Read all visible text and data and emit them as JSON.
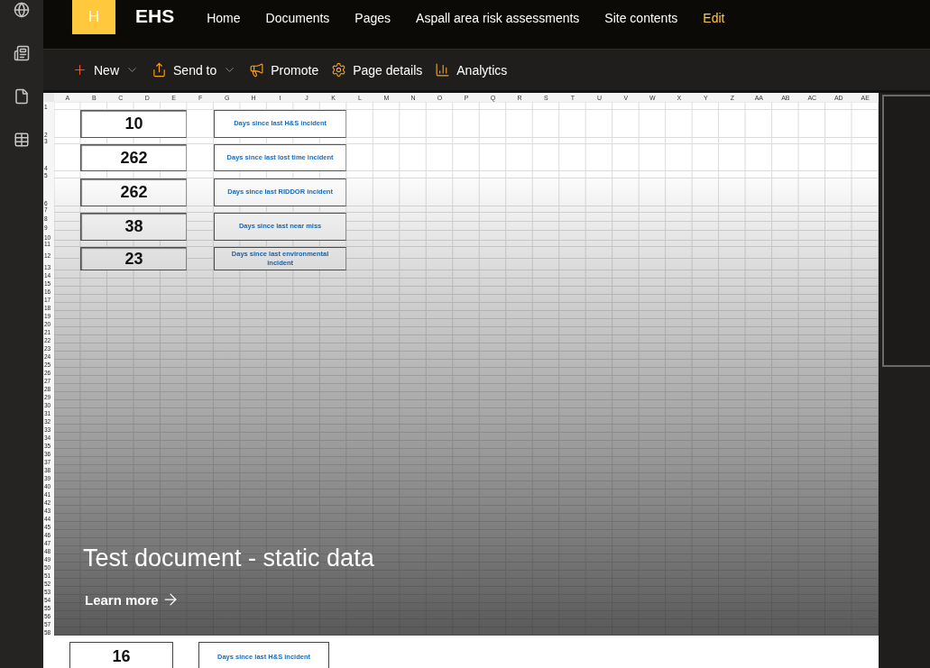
{
  "site": {
    "logo_letter": "H",
    "title": "EHS"
  },
  "nav": [
    {
      "label": "Home",
      "kind": "link"
    },
    {
      "label": "Documents",
      "kind": "link"
    },
    {
      "label": "Pages",
      "kind": "link"
    },
    {
      "label": "Aspall area risk assessments",
      "kind": "link"
    },
    {
      "label": "Site contents",
      "kind": "link"
    },
    {
      "label": "Edit",
      "kind": "edit"
    }
  ],
  "commands": [
    {
      "label": "New",
      "dropdown": true
    },
    {
      "label": "Send to",
      "dropdown": true
    },
    {
      "label": "Promote",
      "dropdown": false
    },
    {
      "label": "Page details",
      "dropdown": false
    },
    {
      "label": "Analytics",
      "dropdown": false
    }
  ],
  "hero": {
    "title": "Test document - static data",
    "link": "Learn more",
    "sheet": {
      "columns": [
        "A",
        "B",
        "C",
        "D",
        "E",
        "F",
        "G",
        "H",
        "I",
        "J",
        "K",
        "L",
        "M",
        "N",
        "O",
        "P",
        "Q",
        "R",
        "S",
        "T",
        "U",
        "V",
        "W",
        "X",
        "Y",
        "Z",
        "AA",
        "AB",
        "AC",
        "AD",
        "AE"
      ],
      "rows": [
        "1",
        "2",
        "3",
        "4",
        "5",
        "6",
        "7",
        "8",
        "9",
        "10",
        "11",
        "12",
        "13",
        "14",
        "15",
        "16",
        "17",
        "18",
        "19",
        "20",
        "21",
        "22",
        "23",
        "24",
        "25",
        "26",
        "27",
        "28",
        "29",
        "30",
        "31",
        "32",
        "33",
        "34",
        "35",
        "36",
        "37",
        "38",
        "39",
        "40",
        "41",
        "42",
        "43",
        "44",
        "45",
        "46",
        "47",
        "48",
        "49",
        "50",
        "51",
        "52",
        "53",
        "54",
        "55",
        "56",
        "57",
        "58"
      ],
      "counters": [
        {
          "value": "10",
          "label": "Days since last H&S incident"
        },
        {
          "value": "262",
          "label": "Days since last lost time incident"
        },
        {
          "value": "262",
          "label": "Days since last RIDDOR incident"
        },
        {
          "value": "38",
          "label": "Days since last near miss"
        },
        {
          "value": "23",
          "label": "Days since last environmental incident"
        }
      ]
    }
  },
  "below": {
    "counters": [
      {
        "value": "16",
        "label": "Days since last H&S incident"
      }
    ]
  }
}
